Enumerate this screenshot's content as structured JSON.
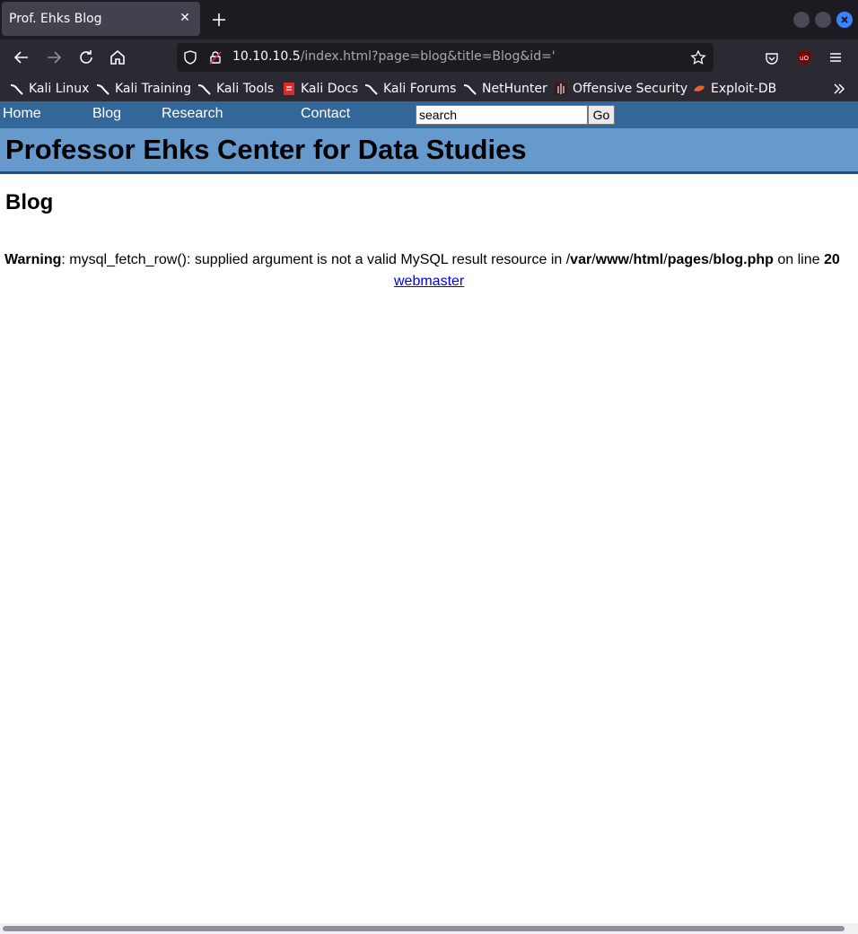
{
  "browser": {
    "tab_title": "Prof. Ehks Blog",
    "tab_close": "✕",
    "url_host": "10.10.10.5",
    "url_rest": "/index.html?page=blog&title=Blog&id='",
    "bookmarks": [
      "Kali Linux",
      "Kali Training",
      "Kali Tools",
      "Kali Docs",
      "Kali Forums",
      "NetHunter",
      "Offensive Security",
      "Exploit-DB"
    ],
    "accent_color": "#3a85ff"
  },
  "site": {
    "nav": [
      "Home",
      "Blog",
      "Research",
      "Contact"
    ],
    "search_value": "search",
    "search_button": "Go",
    "banner_title": "Professor Ehks Center for Data Studies",
    "page_heading": "Blog",
    "warning": {
      "label": "Warning",
      "message": ": mysql_fetch_row(): supplied argument is not a valid MySQL result resource in /",
      "path_parts": [
        "var",
        "www",
        "html",
        "pages",
        "blog.php"
      ],
      "line_text": " on line ",
      "line_number": "20"
    },
    "footer_link": "webmaster",
    "nav_color": "#336699",
    "banner_color": "#6699cc"
  }
}
